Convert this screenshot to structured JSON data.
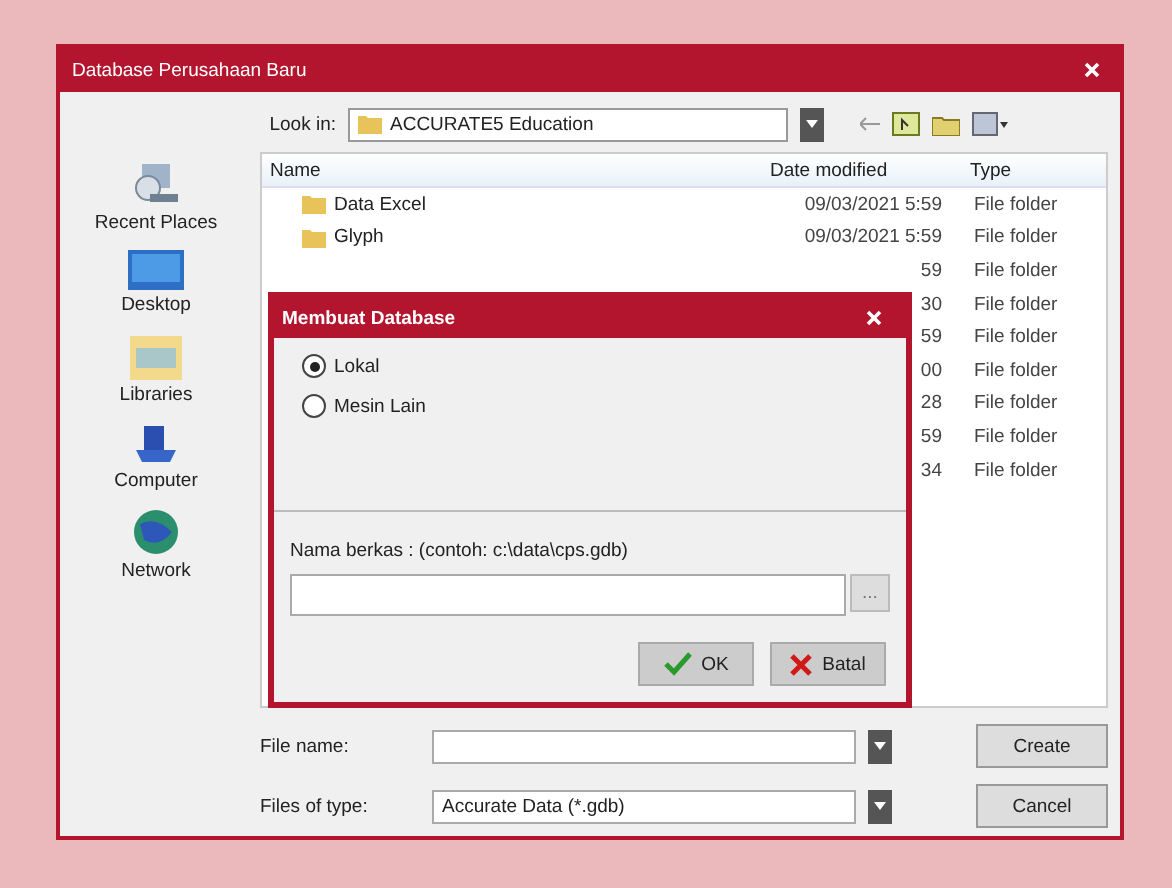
{
  "window": {
    "title": "Database Perusahaan Baru"
  },
  "look_in": {
    "label": "Look in:",
    "value": "ACCURATE5 Education"
  },
  "sidebar": {
    "items": [
      {
        "label": "Recent Places",
        "kind": "recent"
      },
      {
        "label": "Desktop",
        "kind": "desktop"
      },
      {
        "label": "Libraries",
        "kind": "libraries"
      },
      {
        "label": "Computer",
        "kind": "computer"
      },
      {
        "label": "Network",
        "kind": "network"
      }
    ]
  },
  "file_list": {
    "columns": [
      "Name",
      "Date modified",
      "Type"
    ],
    "rows": [
      {
        "name": "Data Excel",
        "date": "09/03/2021 5:59",
        "type": "File folder"
      },
      {
        "name": "Glyph",
        "date": "09/03/2021 5:59",
        "type": "File folder"
      },
      {
        "date": "59",
        "type": "File folder"
      },
      {
        "date": "30",
        "type": "File folder"
      },
      {
        "date": "59",
        "type": "File folder"
      },
      {
        "date": "00",
        "type": "File folder"
      },
      {
        "date": "28",
        "type": "File folder"
      },
      {
        "date": "59",
        "type": "File folder"
      },
      {
        "date": "34",
        "type": "File folder"
      }
    ]
  },
  "file_name": {
    "label": "File name:"
  },
  "files_of_type": {
    "label": "Files of type:",
    "value": "Accurate Data (*.gdb)"
  },
  "buttons": [
    "Create",
    "Cancel"
  ],
  "dialog": {
    "title": "Membuat Database",
    "options": [
      {
        "label": "Lokal",
        "selected": true
      },
      {
        "label": "Mesin Lain",
        "selected": false
      }
    ],
    "field_label": "Nama berkas :  (contoh: c:\\data\\cps.gdb)",
    "browse": "...",
    "buttons": [
      {
        "label": "OK",
        "kind": "ok"
      },
      {
        "label": "Batal",
        "kind": "cancel"
      }
    ]
  }
}
